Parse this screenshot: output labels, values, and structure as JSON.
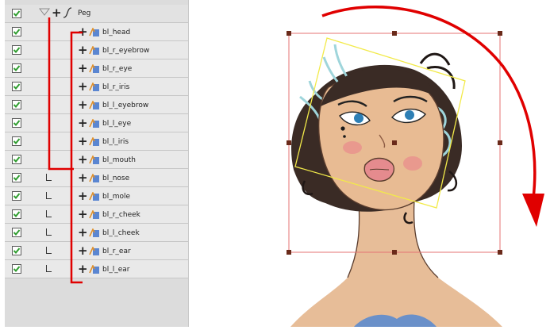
{
  "layers_panel": {
    "peg": {
      "name": "Peg",
      "enabled": true
    },
    "layers": [
      {
        "name": "bl_head",
        "enabled": true
      },
      {
        "name": "bl_r_eyebrow",
        "enabled": true
      },
      {
        "name": "bl_r_eye",
        "enabled": true
      },
      {
        "name": "bl_r_iris",
        "enabled": true
      },
      {
        "name": "bl_l_eyebrow",
        "enabled": true
      },
      {
        "name": "bl_l_eye",
        "enabled": true
      },
      {
        "name": "bl_l_iris",
        "enabled": true
      },
      {
        "name": "bl_mouth",
        "enabled": true
      },
      {
        "name": "bl_nose",
        "enabled": true
      },
      {
        "name": "bl_mole",
        "enabled": true
      },
      {
        "name": "bl_r_cheek",
        "enabled": true
      },
      {
        "name": "bl_l_cheek",
        "enabled": true
      },
      {
        "name": "bl_r_ear",
        "enabled": true
      },
      {
        "name": "bl_l_ear",
        "enabled": true
      }
    ]
  },
  "icons": {
    "checkbox": "checkmark-icon",
    "peg": "peg-icon",
    "add": "plus-icon",
    "drawing": "drawing-layer-icon",
    "rotate": "rotate-arrow-icon"
  },
  "colors": {
    "checkmark": "#2f9d2f",
    "annotation": "#e00000",
    "transform_box": "#e57373",
    "pivot_box": "#f2ea4a"
  }
}
